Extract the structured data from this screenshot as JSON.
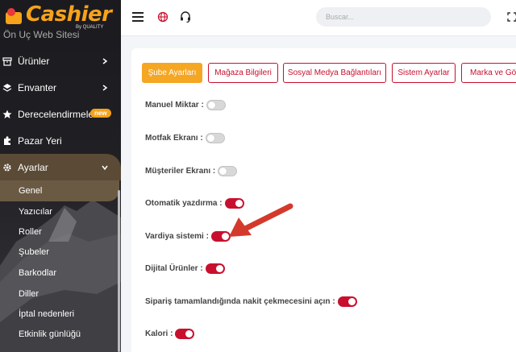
{
  "brand": {
    "name": "Cashier",
    "sub": "By QUALITY",
    "color": "#f7a21b"
  },
  "sidebar": {
    "cut_item": "Ön Uç Web Sitesi",
    "items": [
      {
        "label": "Ürünler",
        "icon": "box-icon"
      },
      {
        "label": "Envanter",
        "icon": "layers-icon"
      },
      {
        "label": "Derecelendirmeler",
        "icon": "star-icon",
        "badge": "new"
      },
      {
        "label": "Pazar Yeri",
        "icon": "puzzle-icon"
      },
      {
        "label": "Ayarlar",
        "icon": "gear-icon"
      }
    ],
    "submenu": [
      "Genel",
      "Yazıcılar",
      "Roller",
      "Şubeler",
      "Barkodlar",
      "Diller",
      "İptal nedenleri",
      "Etkinlik günlüğü"
    ]
  },
  "topbar": {
    "search_placeholder": "Buscar..."
  },
  "tabs": [
    "Şube Ayarları",
    "Mağaza Bilgileri",
    "Sosyal Medya Bağlantıları",
    "Sistem Ayarlar",
    "Marka ve Görü"
  ],
  "settings": [
    {
      "label": "Manuel Miktar :",
      "on": false
    },
    {
      "label": "Motfak Ekranı :",
      "on": false
    },
    {
      "label": "Müşteriler Ekranı :",
      "on": false
    },
    {
      "label": "Otomatik yazdırma :",
      "on": true
    },
    {
      "label": "Vardiya sistemi :",
      "on": true
    },
    {
      "label": "Dijital Ürünler :",
      "on": true
    },
    {
      "label": "Sipariş tamamlandığında nakit çekmecesini açın :",
      "on": true
    },
    {
      "label": "Kalori :",
      "on": true
    }
  ],
  "colors": {
    "accent": "#c8102e",
    "active_tab": "#f5a623",
    "badge": "#f7a21b"
  }
}
